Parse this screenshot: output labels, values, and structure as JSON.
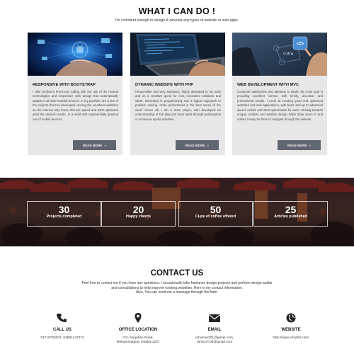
{
  "what_i_can_do": {
    "title": "WHAT I CAN DO !",
    "subtitle": "I'm confident enough to design & develop any types of website or web apps."
  },
  "cards": [
    {
      "title": "RESPONSIVE WITH BOOTSTRAP",
      "body": "I offer proficient Front-end coding with the use of the newest technologies and responsive web design that automatically adapts to all web-enabled devices. In my portfolio, are a few of the projects that I've developed. Among the countless websites on the Internet only those that are speed and SEO optimized yield the desired results. In a wold with exponentially growing use of mobile devices.",
      "button": "READ MORE"
    },
    {
      "title": "DYNAMIC WEBSITE WITH PHP",
      "body": "Responsible and very ambitious, highly dedicated to my work and on a constant quest for new, innovative solutions and ideas. Interested in programming and a logical approach to problem solving. Code perfectionist in the best sense of the word. Above all, I am a team player, who developed an understanding of fair play and team spirit through participation in numerous sports activities.",
      "button": "READ MORE"
    },
    {
      "title": "WEB DEVELOPMENT WITH MVC",
      "body": "Customer satisfaction and attention to detail. My main goal is providing excellent service, with timely, accurate, and professional results. I excel at creating good and optimized websites and web applications, with basic and up to advanced speed, mobile and SEO optimization for each. Striving towards unique, modern and intuitive design helps draw users in and makes it easy for them to navigate through the website.",
      "button": "READ MORE",
      "image_labels": {
        "coding": "Coding",
        "code": "</>"
      }
    }
  ],
  "stats": [
    {
      "number": "30",
      "label": "Projects completed"
    },
    {
      "number": "20",
      "label": "Happy clients"
    },
    {
      "number": "50",
      "label": "Cups of coffee offered"
    },
    {
      "number": "25",
      "label": "Articles published"
    }
  ],
  "contact": {
    "title": "CONTACT US",
    "desc_lines": [
      "Feel free to contact me if you have any questions. I occasionally take freelance design projects and perform design audits",
      "and consultations to help improve existing websites. Here is my contact information.",
      "Also, You can send me a message through the form."
    ],
    "items": [
      {
        "icon": "phone-icon",
        "label": "CALL US",
        "lines": [
          "01719750301,   01881447272"
        ]
      },
      {
        "icon": "map-marker-icon",
        "label": "OFFICE LOCATION",
        "lines": [
          "Y/4, Nurjahan Road,",
          "Mohammadpur, Dhaka-1207"
        ]
      },
      {
        "icon": "envelope-icon",
        "label": "EMAIL",
        "lines": [
          "ruhulcse301@gmail.com,",
          "ruhul.cit.bd@gmail.com"
        ]
      },
      {
        "icon": "globe-icon",
        "label": "WEBSITE",
        "lines": [
          "http://www.ruhulbd.com/"
        ]
      }
    ]
  },
  "colors": {
    "card_bg": "#e7e7e8",
    "button_bg": "#5f6670",
    "stats_overlay": "#3a1e1e",
    "heading": "#111111"
  }
}
